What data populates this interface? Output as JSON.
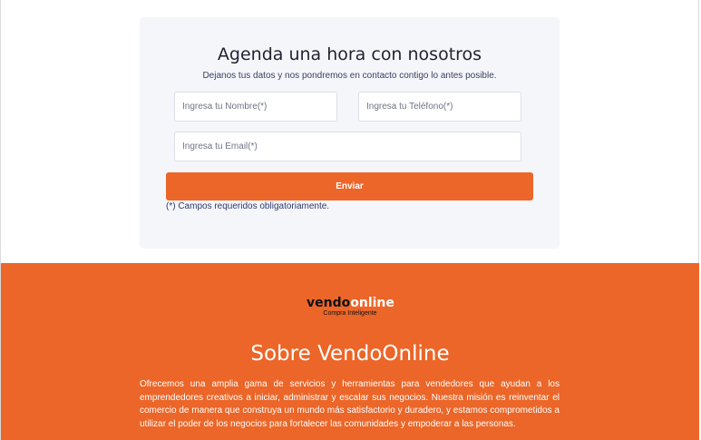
{
  "form": {
    "title": "Agenda una hora con nosotros",
    "subtitle": "Dejanos tus datos y nos pondremos en contacto contigo lo antes posible.",
    "name_placeholder": "Ingresa tu Nombre(*)",
    "phone_placeholder": "Ingresa tu Teléfono(*)",
    "email_placeholder": "Ingresa tu Email(*)",
    "submit_label": "Enviar",
    "required_note": "(*) Campos requeridos obligatoriamente."
  },
  "footer": {
    "logo": {
      "part1": "vendo",
      "part2": "online",
      "tagline": "Compra Inteligente"
    },
    "about_title": "Sobre VendoOnline",
    "about_text": "Ofrecemos una amplia gama de servicios y herramientas para vendedores que ayudan a los emprendedores creativos a iniciar, administrar y escalar sus negocios. Nuestra misión es reinventar el comercio de manera que construya un mundo más satisfactorio y duradero, y estamos comprometidos a utilizar el poder de los negocios para fortalecer las comunidades y empoderar a las personas."
  },
  "colors": {
    "accent": "#ec6629",
    "card_background": "#f5f6fa",
    "title_text": "#1f2330"
  }
}
